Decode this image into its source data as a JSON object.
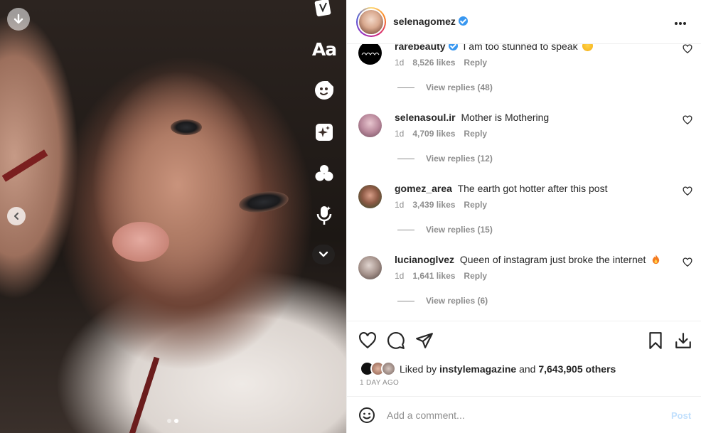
{
  "media": {
    "download_icon": "arrow-down-icon",
    "prev_icon": "chevron-left-icon",
    "carousel": {
      "count": 2,
      "active": 2
    },
    "tools": {
      "text_label": "Aa",
      "icons": [
        "sticker-icon",
        "text-icon",
        "face-sticker-icon",
        "sparkles-icon",
        "circles-icon",
        "mic-icon",
        "chevron-down-icon"
      ]
    }
  },
  "post": {
    "author": "selenagomez",
    "more_icon": "more-icon"
  },
  "comments": [
    {
      "user": "rarebeauty",
      "text": "I am too stunned to speak",
      "emoji": "star-eyes-emoji",
      "verified": true,
      "time": "1d",
      "likes": "8,526 likes",
      "reply": "Reply",
      "view_replies": "View replies (48)"
    },
    {
      "user": "selenasoul.ir",
      "text": "Mother is Mothering",
      "emoji": "",
      "verified": false,
      "time": "1d",
      "likes": "4,709 likes",
      "reply": "Reply",
      "view_replies": "View replies (12)"
    },
    {
      "user": "gomez_area",
      "text": "The earth got hotter after this post",
      "emoji": "",
      "verified": false,
      "time": "1d",
      "likes": "3,439 likes",
      "reply": "Reply",
      "view_replies": "View replies (15)"
    },
    {
      "user": "lucianoglvez",
      "text": "Queen of instagram just broke the internet",
      "emoji": "fire-emoji",
      "verified": false,
      "time": "1d",
      "likes": "1,641 likes",
      "reply": "Reply",
      "view_replies": "View replies (6)"
    }
  ],
  "actions": {
    "like_icon": "heart-icon",
    "comment_icon": "comment-icon",
    "share_icon": "share-icon",
    "save_icon": "bookmark-icon",
    "download_icon": "download-icon"
  },
  "likes": {
    "prefix": "Liked by",
    "by": "instylemagazine",
    "and": "and",
    "others": "7,643,905 others"
  },
  "timestamp": "1 DAY AGO",
  "composer": {
    "emoji_icon": "smiley-icon",
    "placeholder": "Add a comment...",
    "post_label": "Post"
  }
}
